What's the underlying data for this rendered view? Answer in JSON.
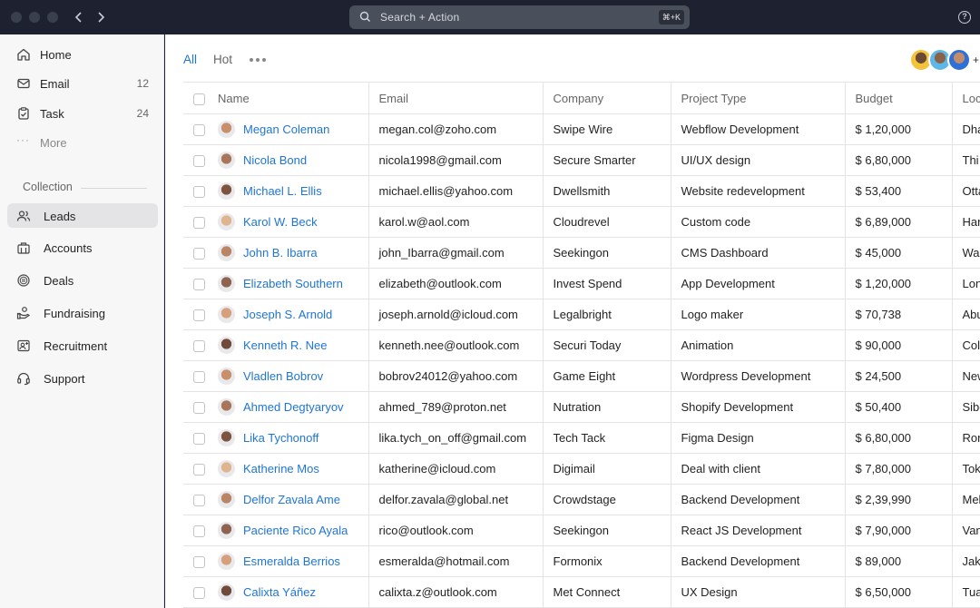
{
  "search": {
    "placeholder": "Search + Action",
    "shortcut": "⌘+K"
  },
  "titlebar": {
    "back_icon": "chevron-left-icon",
    "forward_icon": "chevron-right-icon",
    "help_icon": "help-circle-icon"
  },
  "sidebar": {
    "items": [
      {
        "label": "Home",
        "icon": "home-icon",
        "count": ""
      },
      {
        "label": "Email",
        "icon": "mail-icon",
        "count": "12"
      },
      {
        "label": "Task",
        "icon": "clipboard-icon",
        "count": "24"
      },
      {
        "label": "More",
        "icon": "ellipsis-icon",
        "count": ""
      }
    ],
    "collection_title": "Collection",
    "collection": [
      {
        "label": "Leads",
        "icon": "users-icon",
        "active": true
      },
      {
        "label": "Accounts",
        "icon": "briefcase-icon"
      },
      {
        "label": "Deals",
        "icon": "coin-icon"
      },
      {
        "label": "Fundraising",
        "icon": "hand-coin-icon"
      },
      {
        "label": "Recruitment",
        "icon": "user-plus-icon"
      },
      {
        "label": "Support",
        "icon": "headset-icon"
      }
    ]
  },
  "main": {
    "tabs": [
      {
        "label": "All",
        "active": true
      },
      {
        "label": "Hot",
        "active": false
      }
    ],
    "avatars_more": "+",
    "columns": [
      "Name",
      "Email",
      "Company",
      "Project Type",
      "Budget",
      "Loc"
    ],
    "rows": [
      {
        "name": "Megan Coleman",
        "email": "megan.col@zoho.com",
        "company": "Swipe Wire",
        "project": "Webflow Development",
        "budget": "$ 1,20,000",
        "loc": "Dha"
      },
      {
        "name": "Nicola Bond",
        "email": "nicola1998@gmail.com",
        "company": "Secure Smarter",
        "project": "UI/UX design",
        "budget": "$ 6,80,000",
        "loc": "Thi"
      },
      {
        "name": "Michael L. Ellis",
        "email": "michael.ellis@yahoo.com",
        "company": "Dwellsmith",
        "project": "Website redevelopment",
        "budget": "$ 53,400",
        "loc": "Otta"
      },
      {
        "name": "Karol W. Beck",
        "email": "karol.w@aol.com",
        "company": "Cloudrevel",
        "project": "Custom code",
        "budget": "$ 6,89,000",
        "loc": "Har"
      },
      {
        "name": "John B. Ibarra",
        "email": "john_Ibarra@gmail.com",
        "company": "Seekingon",
        "project": "CMS Dashboard",
        "budget": "$ 45,000",
        "loc": "Was"
      },
      {
        "name": "Elizabeth Southern",
        "email": "elizabeth@outlook.com",
        "company": "Invest Spend",
        "project": "App Development",
        "budget": "$ 1,20,000",
        "loc": "Lon"
      },
      {
        "name": "Joseph S. Arnold",
        "email": "joseph.arnold@icloud.com",
        "company": "Legalbright",
        "project": "Logo maker",
        "budget": "$ 70,738",
        "loc": "Abu"
      },
      {
        "name": "Kenneth R. Nee",
        "email": "kenneth.nee@outlook.com",
        "company": "Securi Today",
        "project": "Animation",
        "budget": "$ 90,000",
        "loc": "Col"
      },
      {
        "name": "Vladlen Bobrov",
        "email": "bobrov24012@yahoo.com",
        "company": "Game Eight",
        "project": "Wordpress Development",
        "budget": "$ 24,500",
        "loc": "New"
      },
      {
        "name": "Ahmed Degtyaryov",
        "email": "ahmed_789@proton.net",
        "company": "Nutration",
        "project": "Shopify Development",
        "budget": "$ 50,400",
        "loc": "Sibe"
      },
      {
        "name": "Lika Tychonoff",
        "email": "lika.tych_on_off@gmail.com",
        "company": "Tech Tack",
        "project": "Figma Design",
        "budget": "$ 6,80,000",
        "loc": "Ron"
      },
      {
        "name": "Katherine Mos",
        "email": "katherine@icloud.com",
        "company": "Digimail",
        "project": "Deal with client",
        "budget": "$ 7,80,000",
        "loc": "Tok"
      },
      {
        "name": "Delfor Zavala Ame",
        "email": "delfor.zavala@global.net",
        "company": "Crowdstage",
        "project": "Backend Development",
        "budget": "$ 2,39,990",
        "loc": "Mel"
      },
      {
        "name": "Paciente Rico Ayala",
        "email": "rico@outlook.com",
        "company": "Seekingon",
        "project": "React JS Development",
        "budget": "$ 7,90,000",
        "loc": "Van"
      },
      {
        "name": "Esmeralda Berrios",
        "email": "esmeralda@hotmail.com",
        "company": "Formonix",
        "project": "Backend Development",
        "budget": "$ 89,000",
        "loc": "Jak"
      },
      {
        "name": "Calixta Yáñez",
        "email": "calixta.z@outlook.com",
        "company": "Met Connect",
        "project": "UX Design",
        "budget": "$ 6,50,000",
        "loc": "Tua"
      }
    ]
  },
  "colors": {
    "accent": "#1f75d6",
    "titlebar": "#1e2230",
    "sidebar": "#f7f7f8",
    "active_item": "#e4e4e6"
  }
}
